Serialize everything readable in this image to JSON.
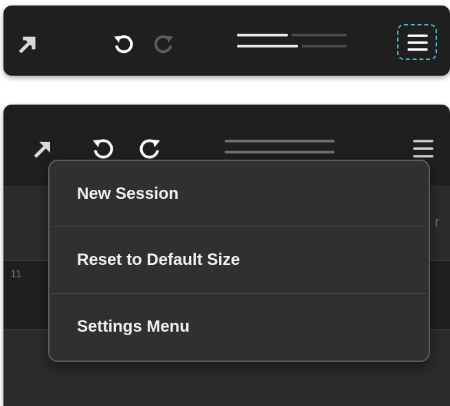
{
  "colors": {
    "panel_bg": "#1f1f1f",
    "menu_bg": "#303030",
    "menu_border": "#5c5c5c",
    "focus_ring": "#4fb3c8",
    "icon": "#ffffff"
  },
  "toolbar_top": {
    "icons": [
      "expand-arrow-icon",
      "undo-icon",
      "redo-icon",
      "hamburger-menu-icon"
    ],
    "meter_level": 0.45
  },
  "background": {
    "row_number": "11",
    "edge_letter": "r"
  },
  "dropdown": {
    "items": [
      {
        "label": "New Session"
      },
      {
        "label": "Reset to Default Size"
      },
      {
        "label": "Settings Menu"
      }
    ]
  }
}
